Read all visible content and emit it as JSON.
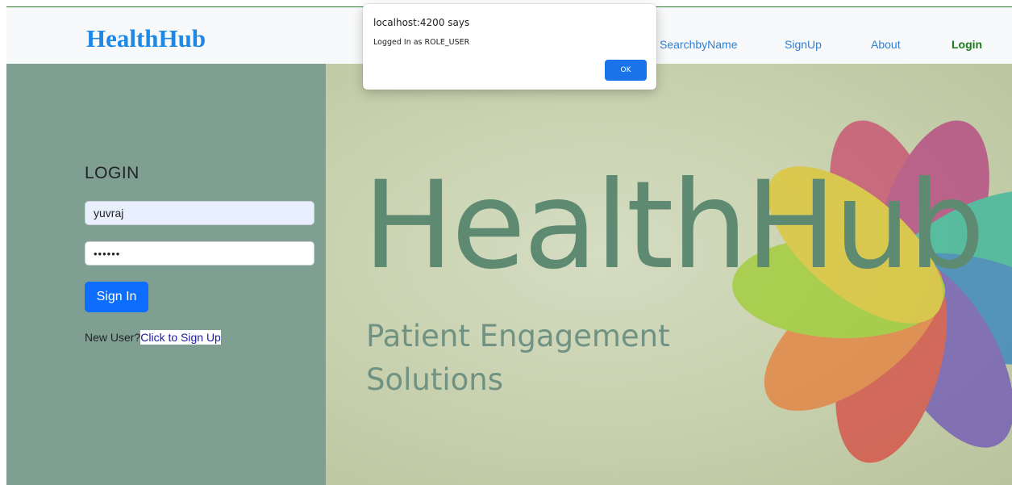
{
  "navbar": {
    "brand": "HealthHub",
    "links": [
      "SearchbyName",
      "SignUp",
      "About",
      "Login"
    ],
    "active": "Login"
  },
  "hero": {
    "logo_text": "HealthHub",
    "tagline_line1": "Patient Engagement",
    "tagline_line2": "Solutions"
  },
  "login": {
    "title": "LOGIN",
    "username_value": "yuvraj",
    "password_value": "••••••",
    "submit_label": "Sign In",
    "new_user_text": "New User?",
    "signup_link": "Click to Sign Up"
  },
  "dialog": {
    "origin": "localhost:4200 says",
    "message": "Logged In as ROLE_USER",
    "ok_label": "OK"
  },
  "colors": {
    "brand": "#1e88e5",
    "nav_link": "#2f7fd1",
    "nav_active": "#1b7a1b",
    "panel": "#7f9f93",
    "primary_button": "#0d6efd",
    "dialog_button": "#1a73e8"
  }
}
